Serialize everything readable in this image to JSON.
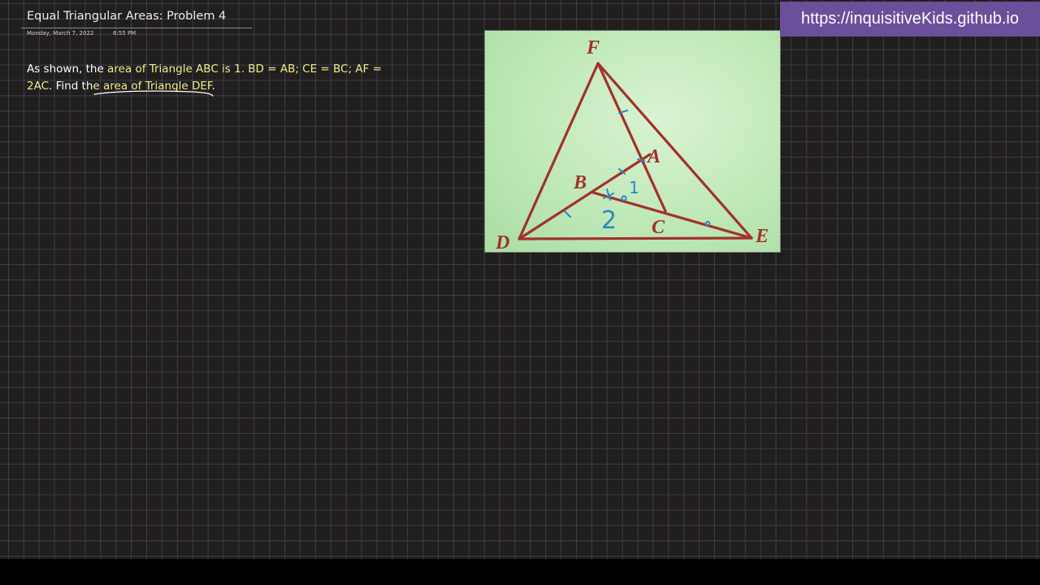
{
  "page": {
    "title": "Equal Triangular Areas: Problem 4",
    "date": "Monday, March 7, 2022",
    "time": "6:55 PM"
  },
  "problem": {
    "part1": "As shown, the ",
    "part2": "area of Triangle ABC is 1. BD = AB; CE = BC; AF =",
    "part3": "2AC",
    "part4": ". Find th",
    "part5": "e area of Triangle DEF",
    "part6": "."
  },
  "figure": {
    "labels": {
      "F": "F",
      "A": "A",
      "B": "B",
      "C": "C",
      "D": "D",
      "E": "E"
    },
    "annotations": {
      "area_abc": "1",
      "area_bdc": "2"
    },
    "colors": {
      "lines": "#a2312a",
      "ink": "#2a86c8",
      "background": "#c5ecbd"
    }
  },
  "badge": {
    "url": "https://inquisitiveKids.github.io",
    "color": "#6a4f9a"
  }
}
